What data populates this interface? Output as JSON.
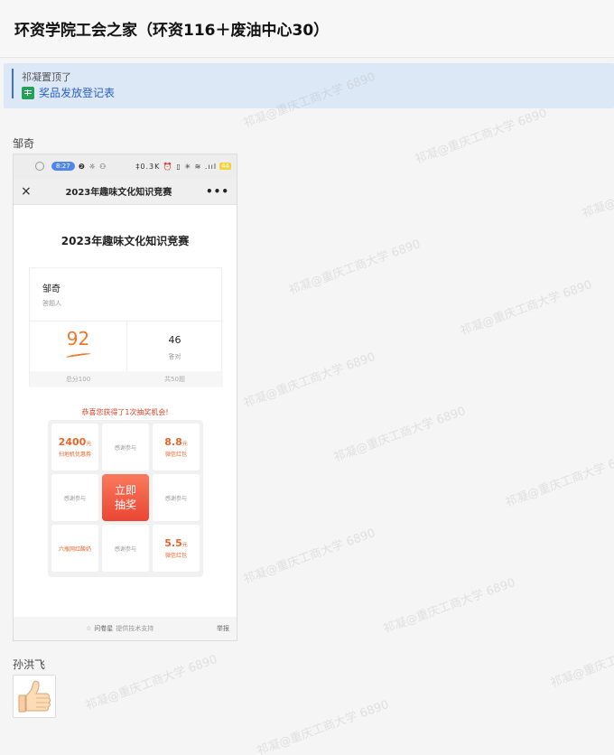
{
  "header": {
    "title": "环资学院工会之家（环资116＋废油中心30）"
  },
  "pinned": {
    "by_text": "祁凝置顶了",
    "link_label": "奖品发放登记表"
  },
  "messages": [
    {
      "sender": "邹奇"
    },
    {
      "sender": "孙洪飞"
    }
  ],
  "screenshot": {
    "status_time": "8:27",
    "status_left": "❷ ☼ ⚇",
    "status_right": "‡0.3K ⏰ ▯ ✳ ≋ .ııl",
    "battery": "44",
    "nav_close": "×",
    "nav_title": "2023年趣味文化知识竞赛",
    "nav_more": "•••",
    "quiz_title": "2023年趣味文化知识竞赛",
    "name": "邹奇",
    "role": "答题人",
    "score": "92",
    "correct": "46",
    "correct_label": "答对",
    "total_label": "总分100",
    "count_label": "共50题",
    "congrats": "恭喜您获得了1次抽奖机会!",
    "prizes": {
      "p1_amount": "2400",
      "p1_unit": "元",
      "p1_desc": "扫地机优惠券",
      "thanks": "感谢参与",
      "p3_amount": "8.8",
      "p3_unit": "元",
      "p3_desc": "微信红包",
      "p7": "六瓶网红酸奶",
      "p9_amount": "5.5",
      "p9_unit": "元",
      "p9_desc": "微信红包"
    },
    "draw_button": "立即\n抽奖",
    "footer_brand": "问卷星",
    "footer_support": "提供技术支持",
    "footer_report": "举报"
  },
  "watermark": {
    "text": "祁凝@重庆工商大学 6890"
  }
}
